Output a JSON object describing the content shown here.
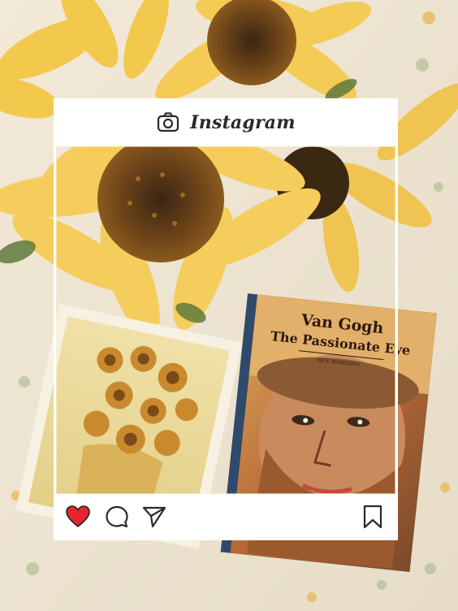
{
  "post": {
    "brand": "Instagram"
  },
  "book": {
    "author": "Van Gogh",
    "title": "The Passionate Eye",
    "series": "NEW HORIZONS"
  },
  "icons": {
    "camera": "camera-icon",
    "like": "heart-icon",
    "comment": "comment-icon",
    "share": "send-icon",
    "save": "bookmark-icon"
  },
  "colors": {
    "like": "#e5262f",
    "frame": "#ffffff",
    "icon": "#2a2a2a"
  }
}
